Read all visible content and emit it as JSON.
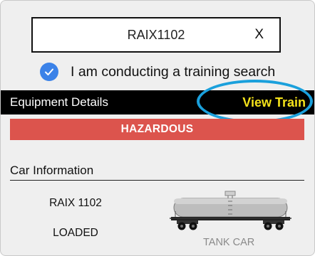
{
  "search": {
    "value": "RAIX1102",
    "clear_label": "X"
  },
  "training": {
    "label": "I am conducting a training search",
    "checked": true
  },
  "header": {
    "title": "Equipment Details",
    "view_train_label": "View Train"
  },
  "hazard_banner": {
    "label": "HAZARDOUS"
  },
  "car_info": {
    "title": "Car Information",
    "car_id": "RAIX 1102",
    "load_status": "LOADED",
    "car_type": "TANK CAR",
    "car_icon": "tank-car-icon"
  },
  "colors": {
    "hazard": "#dc544d",
    "view_train": "#f4e21a",
    "highlight_ring": "#1aa0dc",
    "checkbox": "#3b82e8"
  }
}
